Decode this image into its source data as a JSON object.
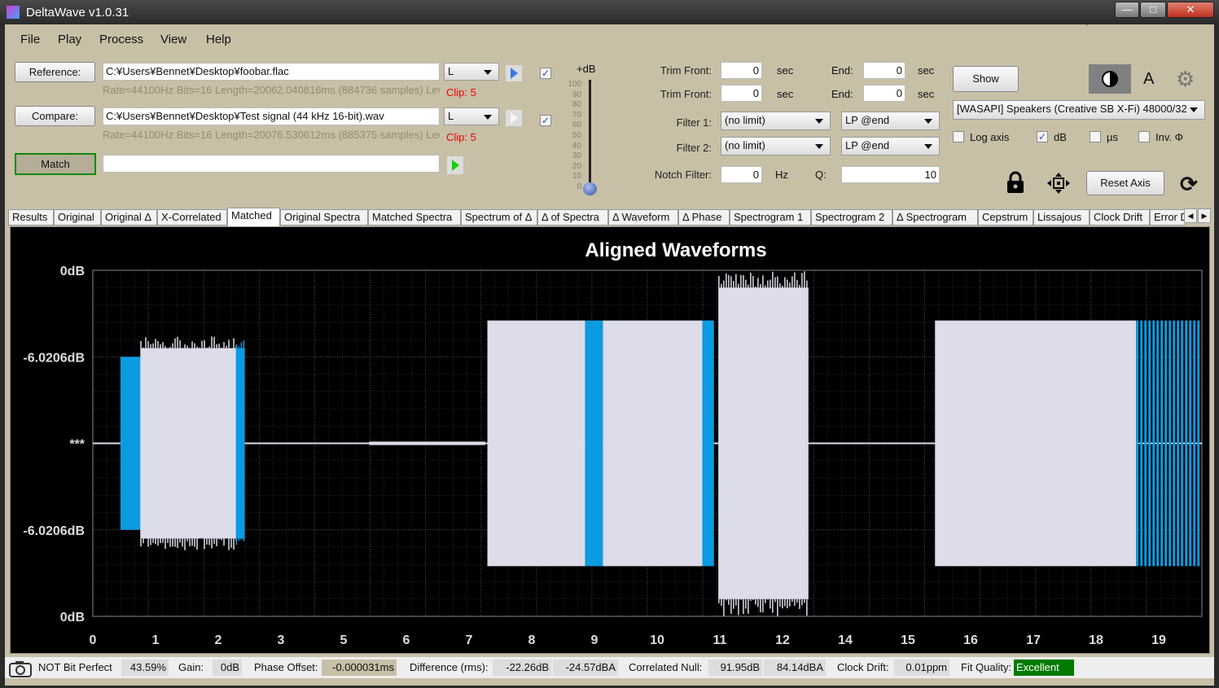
{
  "window": {
    "title": "DeltaWave v1.0.31",
    "minimize": "—",
    "maximize": "□",
    "close": "✕"
  },
  "menu": [
    "File",
    "Play",
    "Process",
    "View",
    "Help"
  ],
  "reference": {
    "button": "Reference:",
    "path": "C:¥Users¥Bennet¥Desktop¥foobar.flac",
    "channel": "L",
    "info": "Rate=44100Hz Bits=16 Length=20062.040816ms (884736 samples) Lev",
    "clip": "Clip: 5",
    "checked": true
  },
  "compare": {
    "button": "Compare:",
    "path": "C:¥Users¥Bennet¥Desktop¥Test signal (44 kHz 16-bit).wav",
    "channel": "L",
    "info": "Rate=44100Hz Bits=16 Length=20076.530612ms (885375 samples) Lev",
    "clip": "Clip: 5",
    "checked": true
  },
  "match": {
    "button": "Match",
    "value": ""
  },
  "level_slider": {
    "label": "+dB",
    "ticks": [
      "100",
      "90",
      "80",
      "70",
      "60",
      "50",
      "40",
      "30",
      "20",
      "10",
      "0"
    ],
    "value": 0
  },
  "trim": [
    {
      "label": "Trim Front:",
      "front": "0",
      "unit": "sec",
      "end_label": "End:",
      "end": "0",
      "end_unit": "sec"
    },
    {
      "label": "Trim Front:",
      "front": "0",
      "unit": "sec",
      "end_label": "End:",
      "end": "0",
      "end_unit": "sec"
    }
  ],
  "filters": [
    {
      "label": "Filter 1:",
      "value": "(no limit)",
      "type": "LP @end"
    },
    {
      "label": "Filter 2:",
      "value": "(no limit)",
      "type": "LP @end"
    }
  ],
  "notch": {
    "label": "Notch Filter:",
    "value": "0",
    "unit": "Hz",
    "q_label": "Q:",
    "q": "10"
  },
  "show_button": "Show",
  "device": "[WASAPI] Speakers (Creative SB X-Fi) 48000/32",
  "theme_a": "A",
  "options": [
    {
      "label": "Log axis",
      "checked": false
    },
    {
      "label": "dB",
      "checked": true
    },
    {
      "label": "µs",
      "checked": false
    },
    {
      "label": "Inv. Φ",
      "checked": false
    }
  ],
  "reset_axis": "Reset Axis",
  "tabs": [
    "Results",
    "Original",
    "Original Δ",
    "X-Correlated",
    "Matched",
    "Original Spectra",
    "Matched Spectra",
    "Spectrum of Δ",
    "Δ of Spectra",
    "Δ Waveform",
    "Δ Phase",
    "Spectrogram 1",
    "Spectrogram 2",
    "Δ Spectrogram",
    "Cepstrum",
    "Lissajous",
    "Clock Drift",
    "Error D"
  ],
  "active_tab": "Matched",
  "chart_data": {
    "type": "area",
    "title": "Aligned Waveforms",
    "xlabel": "",
    "ylabel": "",
    "xlim": [
      0,
      20.07
    ],
    "ylim": [
      -1,
      1
    ],
    "grid": true,
    "x_tick_labels": [
      "0",
      "1",
      "2",
      "3",
      "5",
      "6",
      "7",
      "8",
      "9",
      "10",
      "11",
      "12",
      "14",
      "15",
      "16",
      "17",
      "18",
      "19"
    ],
    "y_tick_labels": [
      {
        "label": "0dB",
        "value": 1
      },
      {
        "label": "-6.0206dB",
        "value": 0.5
      },
      {
        "label": "***",
        "value": 0
      },
      {
        "label": "-6.0206dB",
        "value": -0.5
      },
      {
        "label": "0dB",
        "value": -1
      }
    ],
    "colors": {
      "reference": "#dcdcea",
      "compare": "#0b9be0",
      "background": "#000000",
      "grid": "#555555"
    },
    "segments": [
      {
        "series": "compare",
        "x0": 0.5,
        "x1": 0.87,
        "amp": 0.5
      },
      {
        "series": "reference",
        "x0": 0.87,
        "x1": 2.6,
        "amp": 0.55,
        "spikes": 0.62
      },
      {
        "series": "compare",
        "x0": 2.6,
        "x1": 2.75,
        "amp": 0.55,
        "spikes": 0.6
      },
      {
        "series": "reference",
        "x0": 5.0,
        "x1": 7.1,
        "amp": 0.01
      },
      {
        "series": "reference",
        "x0": 7.14,
        "x1": 8.91,
        "amp": 0.71
      },
      {
        "series": "compare",
        "x0": 8.91,
        "x1": 9.23,
        "amp": 0.71
      },
      {
        "series": "reference",
        "x0": 9.23,
        "x1": 11.03,
        "amp": 0.71
      },
      {
        "series": "compare",
        "x0": 11.03,
        "x1": 11.24,
        "amp": 0.71
      },
      {
        "series": "reference",
        "x0": 11.33,
        "x1": 12.95,
        "amp": 0.9,
        "spikes": 1.0
      },
      {
        "series": "reference",
        "x0": 15.24,
        "x1": 18.88,
        "amp": 0.71
      },
      {
        "series": "compare",
        "x0": 18.88,
        "x1": 20.0,
        "amp": 0.71,
        "stripes": true
      }
    ]
  },
  "status": {
    "bit_perfect": "NOT Bit Perfect",
    "bit_pct": "43.59%",
    "gain_label": "Gain:",
    "gain": "0dB",
    "phase_label": "Phase Offset:",
    "phase": "-0.000031ms",
    "diff_label": "Difference (rms):",
    "diff_db": "-22.26dB",
    "diff_dba": "-24.57dBA",
    "null_label": "Correlated Null:",
    "null_db": "91.95dB",
    "null_dba": "84.14dBA",
    "drift_label": "Clock Drift:",
    "drift": "0.01ppm",
    "fit_label": "Fit Quality:",
    "fit": "Excellent",
    "fit_color": "#007a00"
  }
}
